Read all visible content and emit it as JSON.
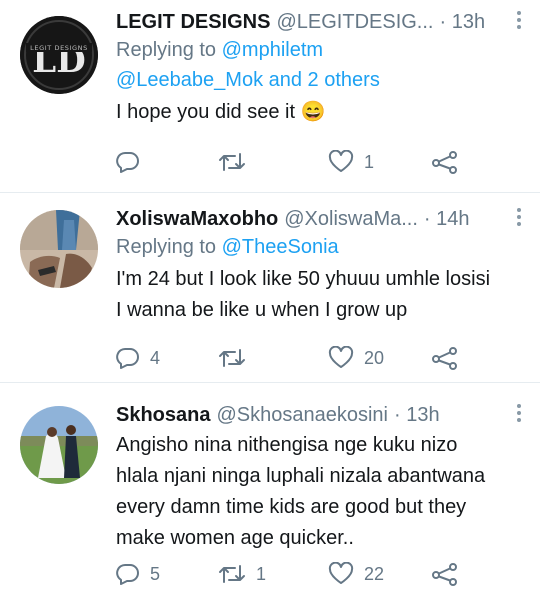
{
  "tweets": [
    {
      "name": "LEGIT DESIGNS",
      "handle": "@LEGITDESIG...",
      "time": "· 13h",
      "replying_prefix": "Replying to ",
      "replying_line1": "@mphiletm",
      "replying_line2": "@Leebabe_Mok and 2 others",
      "text": "I hope you did see it 😄",
      "avatar_text": "LEGIT DESIGNS",
      "avatar_mark": "LD",
      "reply_count": "",
      "retweet_count": "",
      "like_count": "1"
    },
    {
      "name": "XoliswaMaxobho",
      "handle": "@XoliswaMa...",
      "time": "· 14h",
      "replying_prefix": "Replying to ",
      "replying_line1": "@TheeSonia",
      "text_line1": "I'm 24 but I look like 50 yhuuu umhle losisi",
      "text_line2": "I wanna be like u when I grow up",
      "reply_count": "4",
      "retweet_count": "",
      "like_count": "20"
    },
    {
      "name": "Skhosana",
      "handle": "@Skhosanaekosini",
      "time": "· 13h",
      "text_line1": "Angisho nina nithengisa nge kuku nizo",
      "text_line2": "hlala njani ninga luphali nizala abantwana",
      "text_line3": "every damn time kids are good but they",
      "text_line4": "make women age quicker..",
      "reply_count": "5",
      "retweet_count": "1",
      "like_count": "22"
    }
  ],
  "icons": {
    "reply": "speech-bubble-icon",
    "retweet": "retweet-icon",
    "like": "heart-icon",
    "share": "share-icon",
    "more": "more-vertical-icon"
  },
  "colors": {
    "link": "#1da1f2",
    "secondary": "#657786",
    "divider": "#e6ecf0"
  }
}
